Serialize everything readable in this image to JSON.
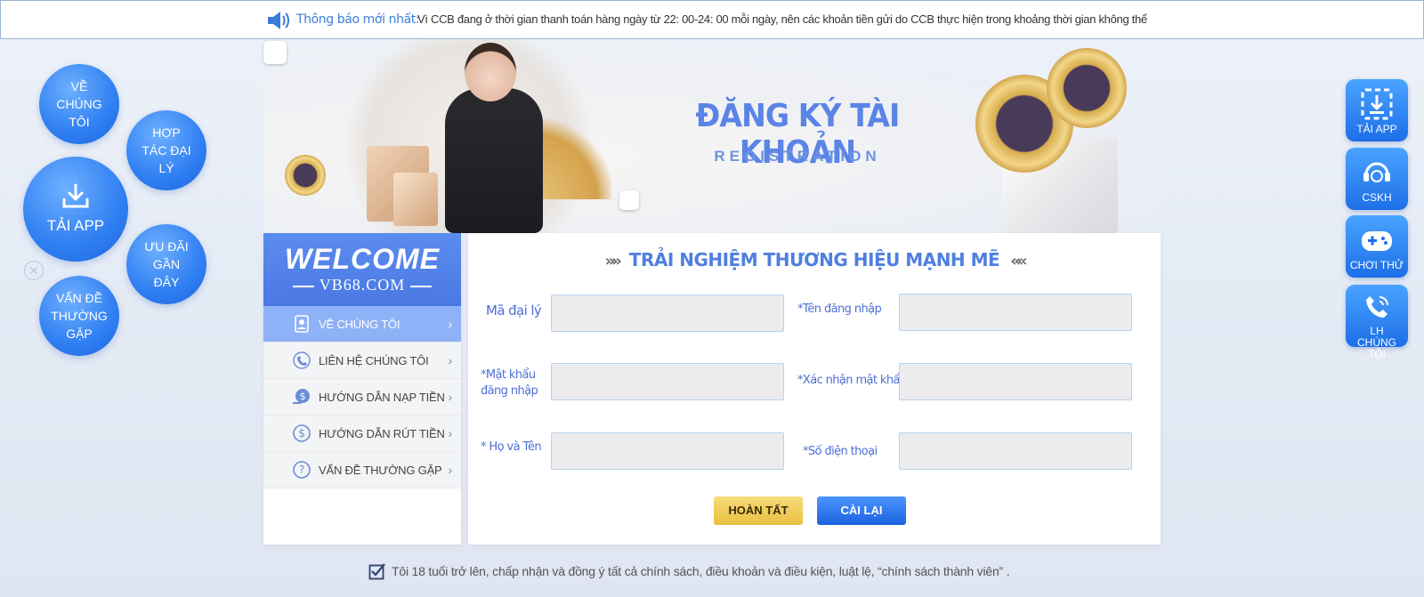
{
  "notice": {
    "label": "Thông báo mới nhất:",
    "text": "Vì CCB đang ở thời gian thanh toán hàng ngày từ 22: 00-24: 00 mỗi ngày, nên các khoản tiền gửi do CCB thực hiện trong khoảng thời gian không thể"
  },
  "banner": {
    "title": "ĐĂNG KÝ TÀI KHOẢN",
    "subtitle": "REGISTRATION"
  },
  "left_bubbles": {
    "about": "VỀ CHÚNG TÔI",
    "agency": "HỢP TÁC ĐẠI LÝ",
    "app": "TẢI APP",
    "promo": "ƯU ĐÃI GẦN ĐÂY",
    "faq": "VẤN ĐỀ THƯỜNG GẶP"
  },
  "right_buttons": {
    "app": "TẢI APP",
    "support": "CSKH",
    "try": "CHƠI THỬ",
    "contact": "LH CHÚNG TÔI"
  },
  "menu": {
    "welcome": "WELCOME",
    "site": "VB68.COM",
    "items": [
      {
        "label": "VỀ CHÚNG TÔI"
      },
      {
        "label": "LIÊN HỆ CHÚNG TÔI"
      },
      {
        "label": "HƯỚNG DẪN NẠP TIỀN"
      },
      {
        "label": "HƯỚNG DẪN RÚT TIỀN"
      },
      {
        "label": "VẤN ĐỀ THƯỜNG GẶP"
      }
    ]
  },
  "form": {
    "title": "TRẢI NGHIỆM THƯƠNG HIỆU MẠNH MẼ",
    "fields": {
      "agent_code": {
        "label": "Mã đại lý",
        "value": "",
        "placeholder": ""
      },
      "username": {
        "label": "*Tên đăng nhập",
        "value": "",
        "placeholder": ""
      },
      "password": {
        "label": "*Mật khẩu đăng nhập",
        "value": "",
        "placeholder": ""
      },
      "confirm_password": {
        "label": "*Xác nhận mật khẩu",
        "value": "",
        "placeholder": ""
      },
      "full_name": {
        "label": "* Họ và Tên",
        "value": "",
        "placeholder": ""
      },
      "phone": {
        "label": "*Số điện thoại",
        "value": "",
        "placeholder": ""
      }
    },
    "submit_label": "HOÀN TẤT",
    "reset_label": "CÀI LẠI"
  },
  "agreement": {
    "text": "Tôi 18 tuổi trở lên, chấp nhận và đồng ý tất cả chính sách, điều khoản và điều kiện, luật lệ, “chính sách thành viên” .",
    "checked": true
  },
  "colors": {
    "accent": "#4f7fe0",
    "button_blue": "#1d6fe8",
    "button_gold": "#e9bf3f"
  }
}
